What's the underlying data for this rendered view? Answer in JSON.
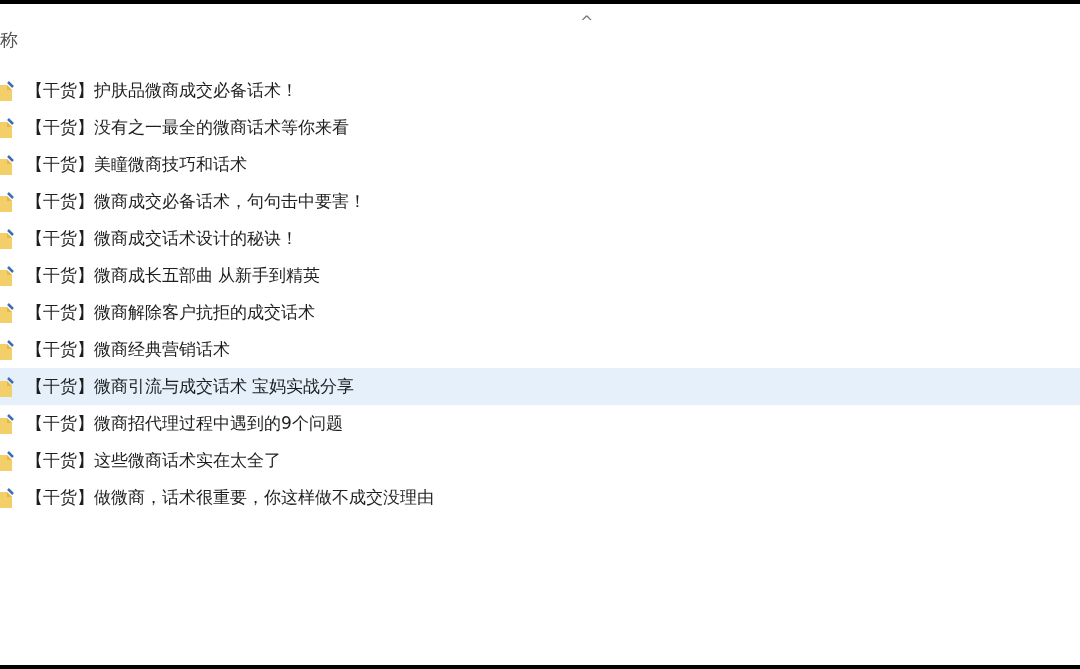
{
  "column_header": {
    "label": "称",
    "sort_indicator": "^"
  },
  "files": [
    {
      "name": "【干货】护肤品微商成交必备话术！",
      "selected": false
    },
    {
      "name": "【干货】没有之一最全的微商话术等你来看",
      "selected": false
    },
    {
      "name": "【干货】美瞳微商技巧和话术",
      "selected": false
    },
    {
      "name": "【干货】微商成交必备话术，句句击中要害！",
      "selected": false
    },
    {
      "name": "【干货】微商成交话术设计的秘诀！",
      "selected": false
    },
    {
      "name": "【干货】微商成长五部曲 从新手到精英",
      "selected": false
    },
    {
      "name": "【干货】微商解除客户抗拒的成交话术",
      "selected": false
    },
    {
      "name": "【干货】微商经典营销话术",
      "selected": false
    },
    {
      "name": "【干货】微商引流与成交话术 宝妈实战分享",
      "selected": true
    },
    {
      "name": "【干货】微商招代理过程中遇到的9个问题",
      "selected": false
    },
    {
      "name": "【干货】这些微商话术实在太全了",
      "selected": false
    },
    {
      "name": "【干货】做微商，话术很重要，你这样做不成交没理由",
      "selected": false
    }
  ]
}
